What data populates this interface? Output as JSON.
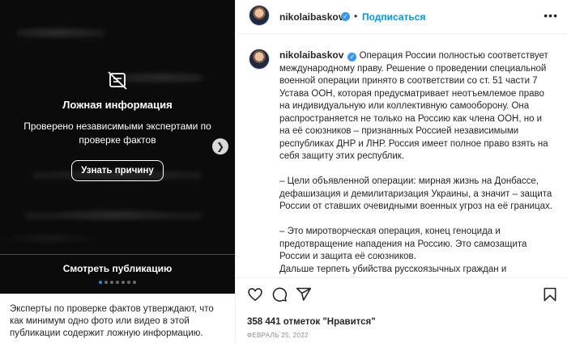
{
  "media": {
    "overlay_title": "Ложная информация",
    "overlay_description": "Проверено независимыми экспертами по проверке фактов",
    "reason_button": "Узнать причину",
    "view_post": "Смотреть публикацию",
    "carousel": {
      "total_slides": 7,
      "active_slide": 1
    }
  },
  "fact_check_footer": "Эксперты по проверке фактов утверждают, что как минимум одно фото или видео в этой публикации содержит ложную информацию.",
  "header": {
    "username": "nikolaibaskov",
    "separator": "•",
    "follow_label": "Подписаться",
    "more_label": "•••"
  },
  "caption": {
    "username": "nikolaibaskov",
    "text": "Операция России полностью соответствует международному праву. Решение о проведении специальной военной операции принято в соответствии со ст. 51 части 7 Устава ООН, которая предусматривает неотъемлемое право на индивидуальную или коллективную самооборону. Она распространяется не только на Россию как члена ООН, но и на её союзников – признанных Россией независимыми республиках ДНР и ЛНР. Россия имеет полное право взять на себя защиту этих республик.\n\n– Цели объявленной операции: мирная жизнь на Донбассе, дефашизация и демилитаризация Украины, а значит – защита России от ставших очевидными военных угроз на её границах.\n\n– Это миротворческая операция, конец геноцида и предотвращение нападения на Россию. Это самозащита России и защита её союзников.\nДальше терпеть убийства русскоязычных граждан и"
  },
  "post": {
    "likes": "358 441 отметок \"Нравится\"",
    "date": "ФЕВРАЛЬ 25, 2022"
  },
  "colors": {
    "accent": "#0095f6",
    "verified": "#3897f0",
    "media_bg": "#0b0b0b"
  },
  "icons": [
    "fact-check-eye-off-icon",
    "chevron-right-icon",
    "verified-badge-icon",
    "heart-icon",
    "comment-icon",
    "share-icon",
    "bookmark-icon"
  ]
}
